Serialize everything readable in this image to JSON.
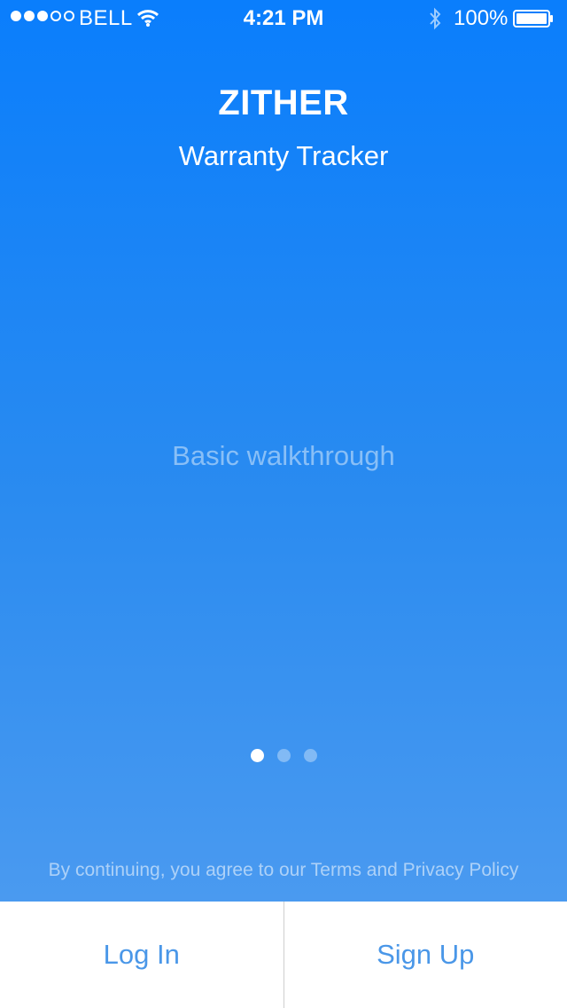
{
  "status_bar": {
    "carrier": "BELL",
    "time": "4:21 PM",
    "battery_percent": "100%",
    "signal_bars_filled": 3,
    "signal_bars_total": 5
  },
  "header": {
    "brand": "ZITHER",
    "subtitle": "Warranty Tracker"
  },
  "main": {
    "placeholder": "Basic walkthrough",
    "page_count": 3,
    "active_page": 1
  },
  "footer": {
    "terms": "By continuing, you agree to our Terms and Privacy Policy",
    "login_label": "Log In",
    "signup_label": "Sign Up"
  },
  "colors": {
    "accent": "#0a7efc",
    "button_text": "#4a97e8"
  }
}
